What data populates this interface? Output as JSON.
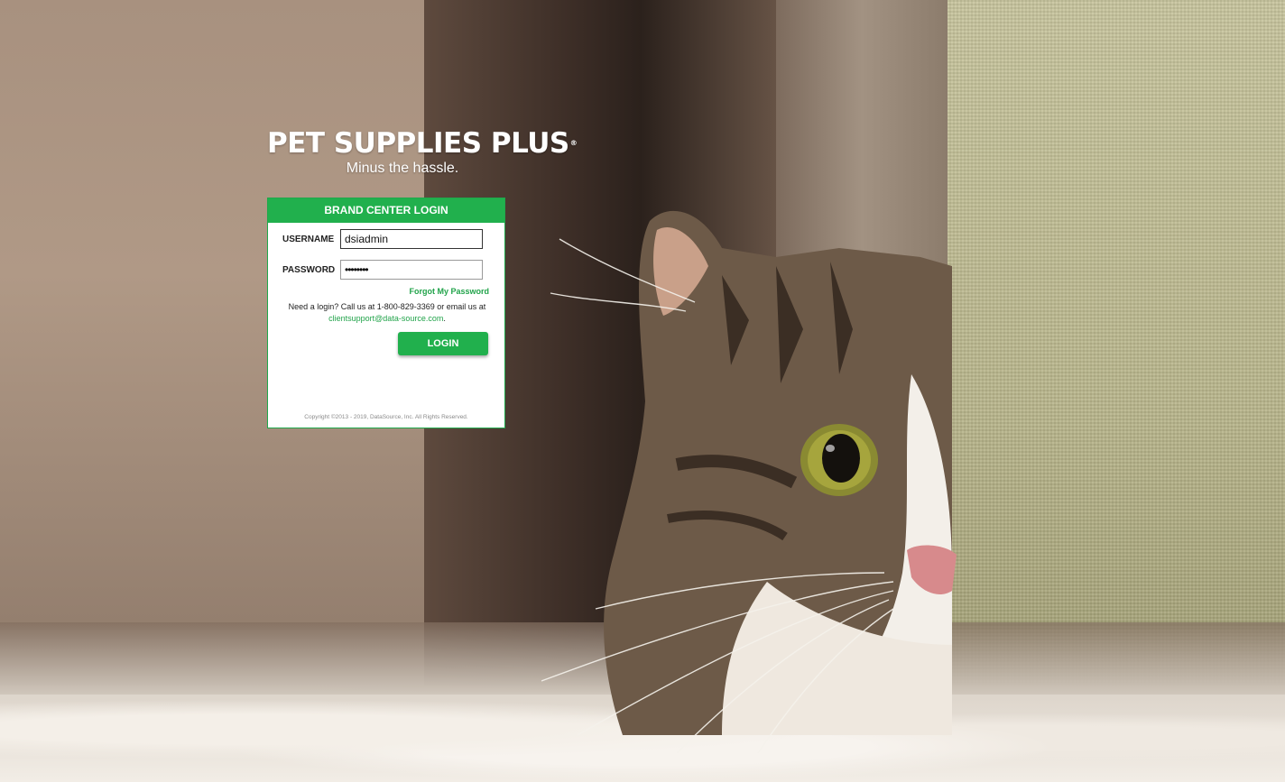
{
  "brand": {
    "title": "PET SUPPLIES PLUS",
    "registered_mark": "®",
    "tagline": "Minus the hassle."
  },
  "login": {
    "header": "BRAND CENTER LOGIN",
    "username_label": "USERNAME",
    "username_value": "dsiadmin",
    "password_label": "PASSWORD",
    "password_value": "••••••••",
    "forgot_link": "Forgot My Password",
    "help_text_prefix": "Need a login? Call us at 1-800-829-3369 or email us at",
    "help_email": "clientsupport@data-source.com",
    "help_text_suffix": ".",
    "login_button": "LOGIN",
    "copyright": "Copyright ©2013 - 2019, DataSource, Inc. All Rights Reserved."
  },
  "colors": {
    "accent_green": "#21b04d",
    "link_green": "#21a34a"
  }
}
